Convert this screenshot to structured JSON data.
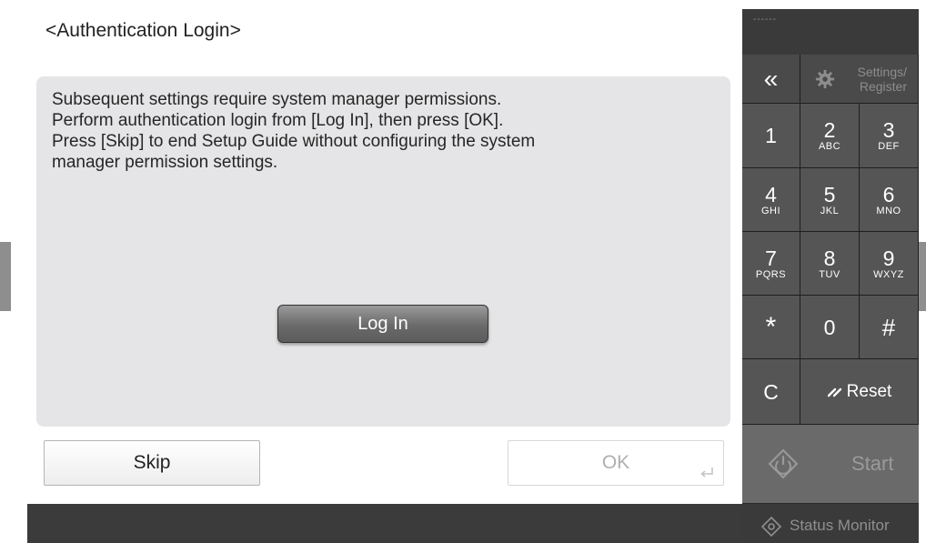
{
  "screen": {
    "title": "<Authentication Login>",
    "message_lines": [
      "Subsequent settings require system manager permissions.",
      "Perform authentication login from [Log In], then press [OK].",
      "Press [Skip] to end Setup Guide without configuring the system",
      "manager permission settings."
    ],
    "login_label": "Log In",
    "skip_label": "Skip",
    "ok_label": "OK"
  },
  "keypad": {
    "top_indicator": "------",
    "back_symbol": "«",
    "settings_label_line1": "Settings/",
    "settings_label_line2": "Register",
    "keys": [
      {
        "num": "1",
        "sub": ""
      },
      {
        "num": "2",
        "sub": "ABC"
      },
      {
        "num": "3",
        "sub": "DEF"
      },
      {
        "num": "4",
        "sub": "GHI"
      },
      {
        "num": "5",
        "sub": "JKL"
      },
      {
        "num": "6",
        "sub": "MNO"
      },
      {
        "num": "7",
        "sub": "PQRS"
      },
      {
        "num": "8",
        "sub": "TUV"
      },
      {
        "num": "9",
        "sub": "WXYZ"
      },
      {
        "num": "*",
        "sub": ""
      },
      {
        "num": "0",
        "sub": ""
      },
      {
        "num": "#",
        "sub": ""
      }
    ],
    "clear_label": "C",
    "reset_label": "Reset",
    "start_label": "Start",
    "status_monitor_label": "Status Monitor"
  }
}
